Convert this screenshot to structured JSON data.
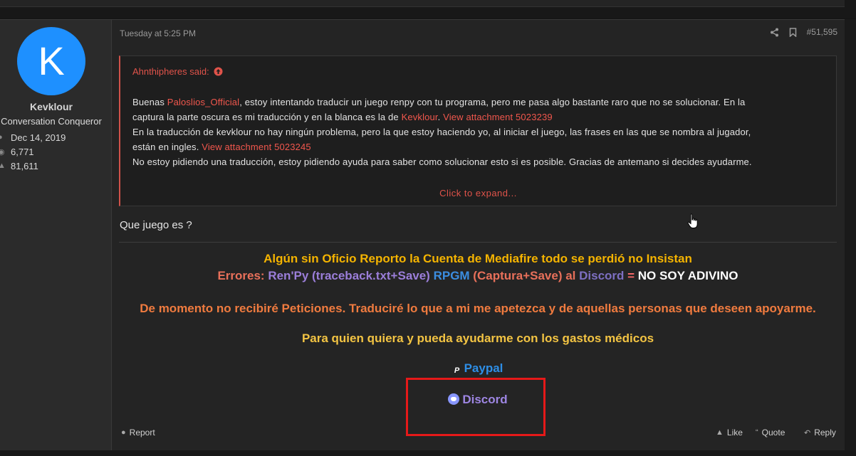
{
  "user": {
    "avatar_letter": "K",
    "name": "Kevklour",
    "title": "Conversation Conqueror",
    "joined": "Dec 14, 2019",
    "messages": "6,771",
    "reactions": "81,611"
  },
  "post": {
    "date": "Tuesday at 5:25 PM",
    "number": "#51,595"
  },
  "quote": {
    "author": "Ahnthipheres said:",
    "line1_a": "Buenas ",
    "line1_mention": "Paloslios_Official",
    "line1_b": ", estoy intentando traducir un juego renpy con tu programa, pero me pasa algo bastante raro que no se solucionar. En la",
    "line2_a": "captura la parte oscura es mi traducción y en la blanca es la de ",
    "line2_mention": "Kevklour",
    "line2_b": ". ",
    "line2_link": "View attachment 5023239",
    "line3": "En la traducción de kevklour no hay ningún problema, pero la que estoy haciendo yo, al iniciar el juego, las frases en las que se nombra al jugador,",
    "line4_a": "están en ingles. ",
    "line4_link": "View attachment 5023245",
    "line5": "No estoy pidiendo una traducción, estoy pidiendo ayuda para saber como solucionar esto si es posible. Gracias de antemano si decides ayudarme.",
    "expand": "Click to expand..."
  },
  "reply": {
    "text": "Que juego es ?"
  },
  "signature": {
    "line1": "Algún sin Oficio Reporto la Cuenta de Mediafire todo se perdió no Insistan",
    "errors_label": "Errores: ",
    "renpy": "Ren'Py",
    "renpy_detail": " (traceback.txt+Save) ",
    "rpgm": "RPGM",
    "rpgm_detail": " (Captura+Save) al ",
    "discord_word": "Discord",
    "equals": " = ",
    "no_soy": "NO SOY ADIVINO",
    "line3": "De momento no recibiré Peticiones. Traduciré lo que a mi me apetezca y de aquellas personas que deseen apoyarme.",
    "line4": "Para quien quiera y pueda ayudarme con los gastos médicos",
    "paypal": "Paypal",
    "discord": "Discord"
  },
  "footer": {
    "report": "Report",
    "like": "Like",
    "quote": "Quote",
    "reply": "Reply"
  },
  "colors": {
    "avatar": "#1e90ff",
    "mention": "#f1574d",
    "highlight": "#e51919"
  }
}
